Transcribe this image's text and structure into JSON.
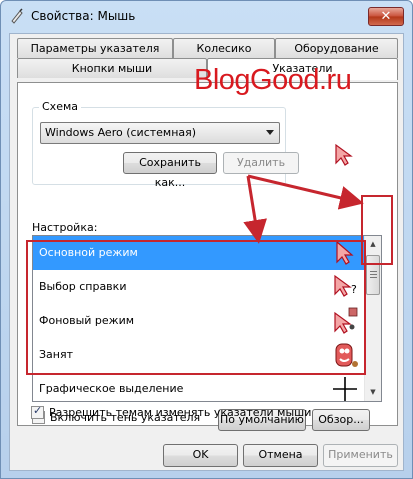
{
  "window": {
    "title": "Свойства: Мышь",
    "close_label": "✕"
  },
  "tabs": {
    "row1": [
      "Параметры указателя",
      "Колесико",
      "Оборудование"
    ],
    "row2": [
      "Кнопки мыши",
      "Указатели"
    ],
    "active": "Указатели"
  },
  "scheme": {
    "legend": "Схема",
    "selected": "Windows Aero (системная)",
    "save_label": "Сохранить как...",
    "delete_label": "Удалить"
  },
  "customize": {
    "label": "Настройка:",
    "items": [
      {
        "label": "Основной режим",
        "icon": "arrow-cursor-icon",
        "selected": true
      },
      {
        "label": "Выбор справки",
        "icon": "help-cursor-icon",
        "selected": false
      },
      {
        "label": "Фоновый режим",
        "icon": "working-cursor-icon",
        "selected": false
      },
      {
        "label": "Занят",
        "icon": "busy-cursor-icon",
        "selected": false
      },
      {
        "label": "Графическое выделение",
        "icon": "crosshair-cursor-icon",
        "selected": false
      }
    ]
  },
  "options": {
    "shadow_label": "Включить тень указателя",
    "shadow_checked": true,
    "default_label": "По умолчанию",
    "browse_label": "Обзор...",
    "themes_label": "Разрешить темам изменять указатели мыши",
    "themes_checked": true
  },
  "footer": {
    "ok": "OK",
    "cancel": "Отмена",
    "apply": "Применить"
  },
  "watermark": "BlogGood.ru",
  "colors": {
    "accent_selection": "#3399ff",
    "annotation_red": "#c6262e",
    "cursor_fill": "#f4a6a6"
  }
}
